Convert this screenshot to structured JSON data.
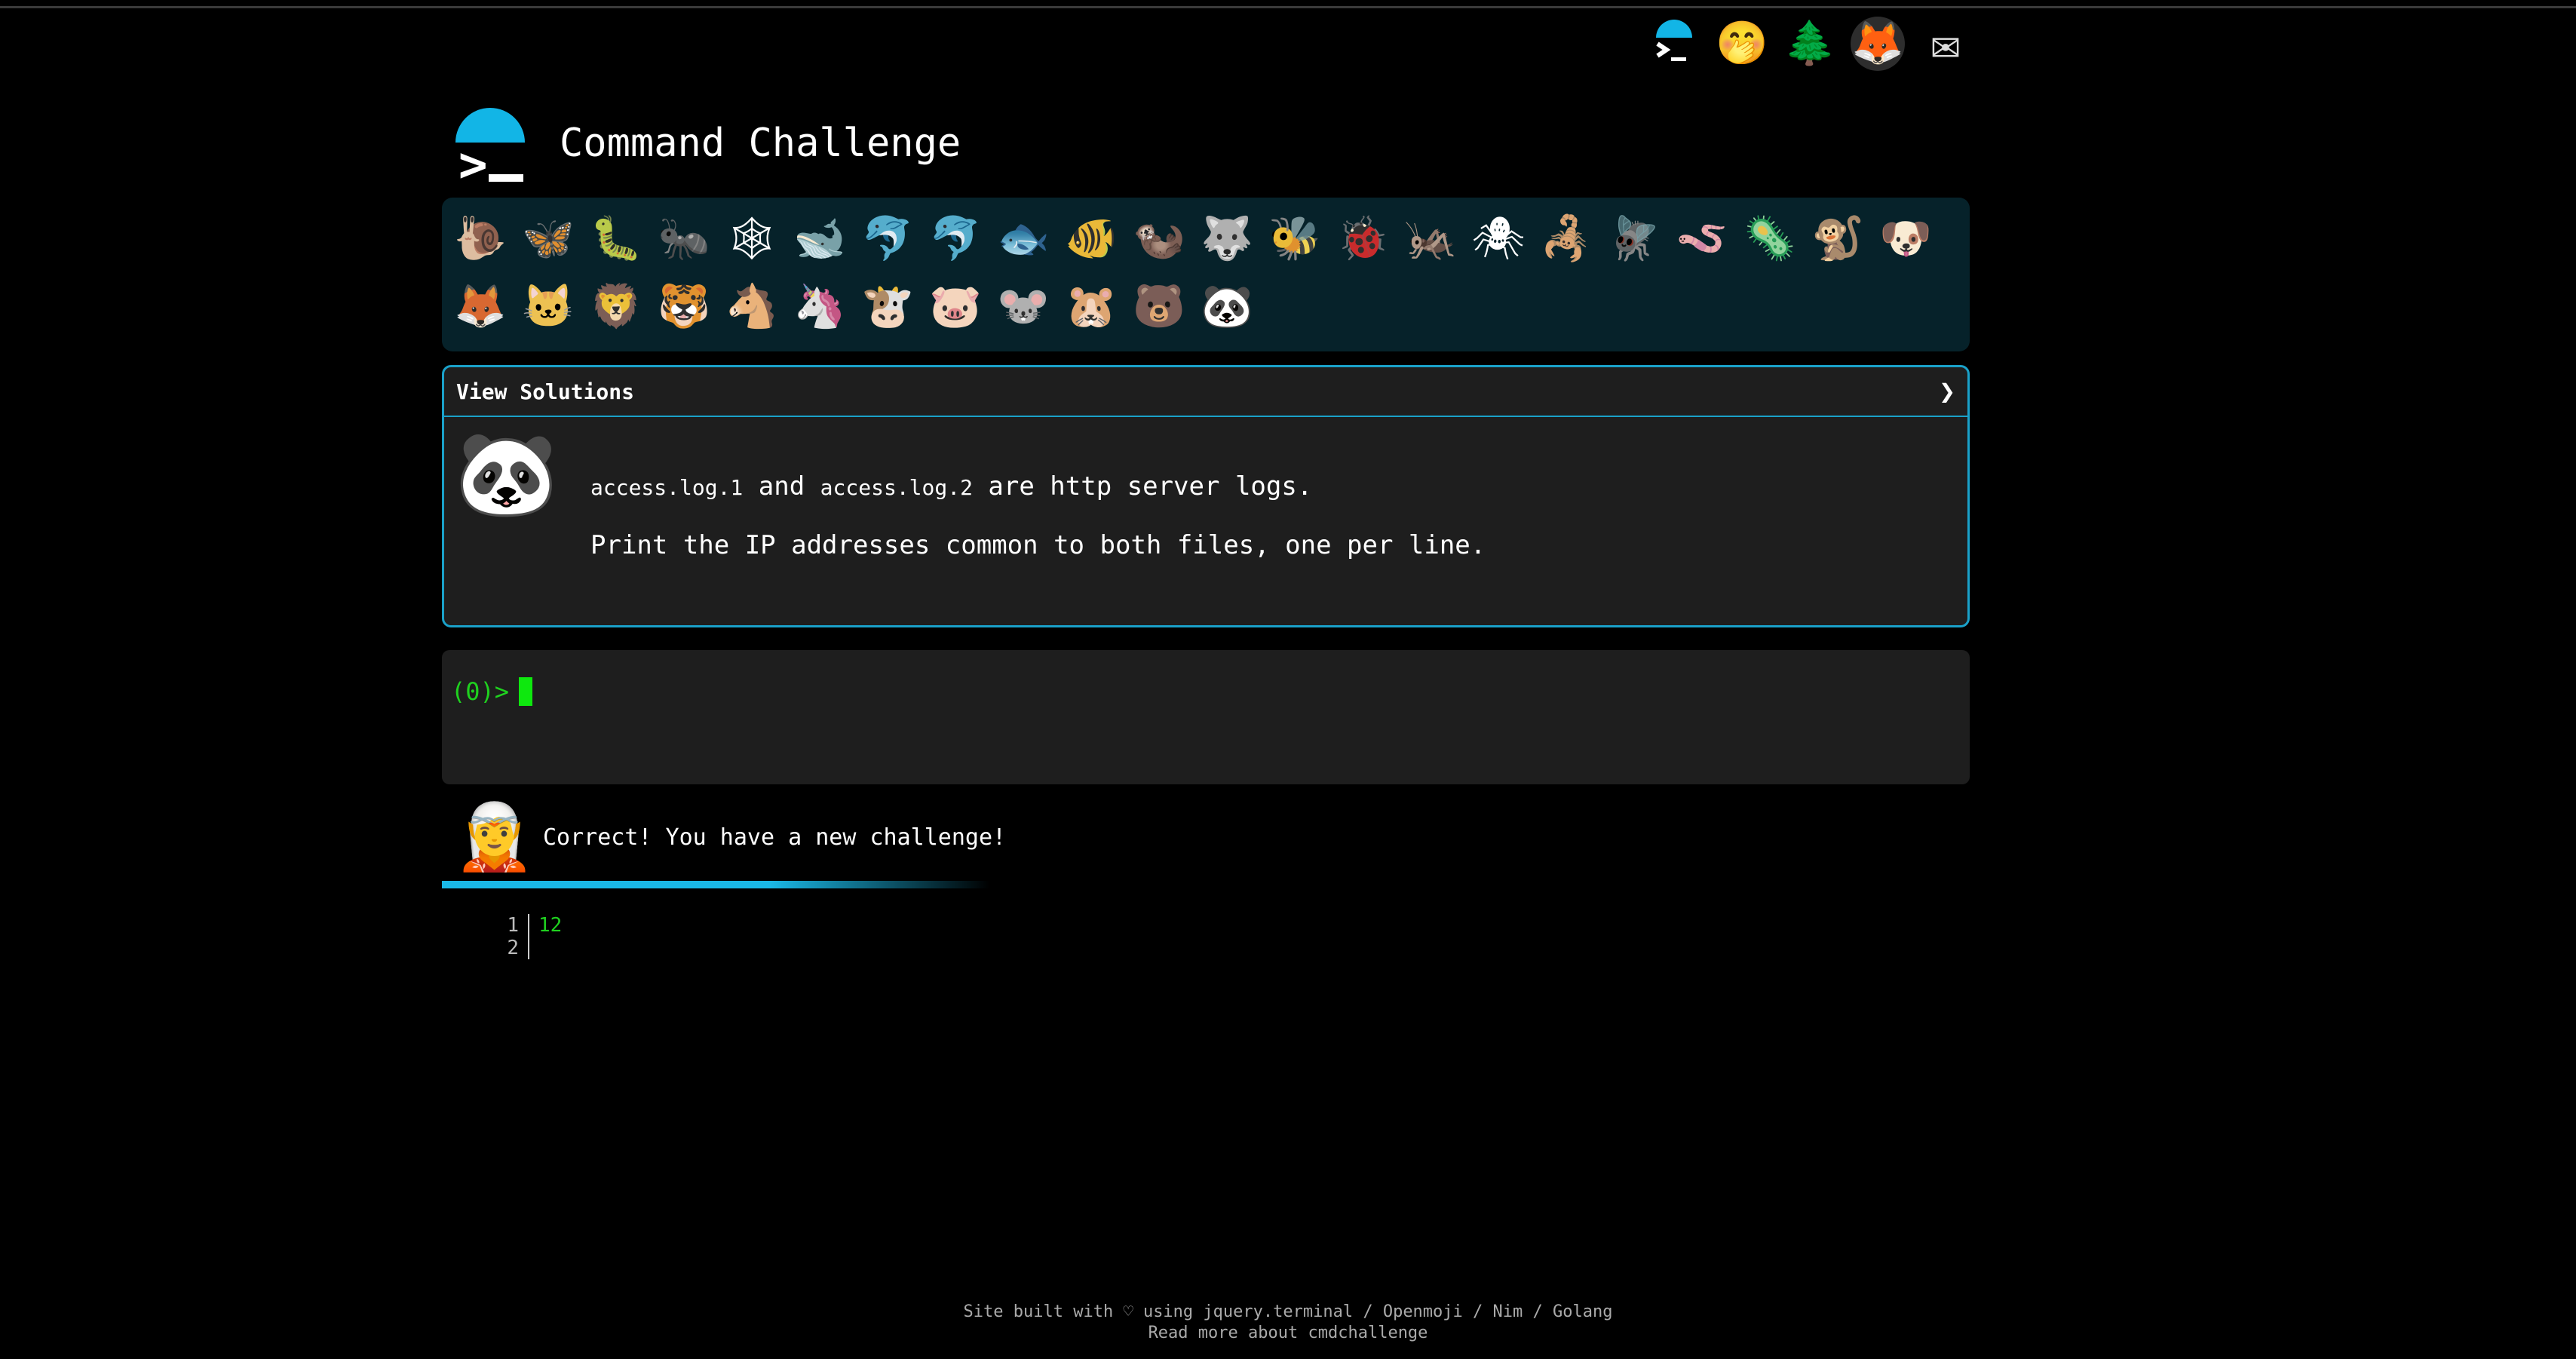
{
  "app": {
    "title": "Command Challenge"
  },
  "topbar": {
    "icons": [
      {
        "name": "cmd-logo-icon",
        "glyph": ">_"
      },
      {
        "name": "shushing-face-icon",
        "glyph": "🤭"
      },
      {
        "name": "tree-icon",
        "glyph": "🌲"
      },
      {
        "name": "gitlab-icon",
        "glyph": "🦊"
      },
      {
        "name": "mail-icon",
        "glyph": "✉"
      }
    ]
  },
  "animals": [
    "🐌",
    "🦋",
    "🐛",
    "🐜",
    "🕸",
    "🐋",
    "🐬",
    "🐬",
    "🐟",
    "🐠",
    "🦦",
    "🐺",
    "🐝",
    "🐞",
    "🦗",
    "🕷",
    "🦂",
    "🪰",
    "🪱",
    "🦠",
    "🐒",
    "🐶",
    "🦊",
    "🐱",
    "🦁",
    "🐯",
    "🐴",
    "🦄",
    "🐮",
    "🐷",
    "🐭",
    "🐹",
    "🐻",
    "🐼"
  ],
  "panel": {
    "header_label": "View Solutions",
    "chevron": "❯",
    "avatar": "🐼",
    "file1": "access.log.1",
    "and": " and ",
    "file2": "access.log.2",
    "line1_tail": " are http server logs.",
    "line2": "Print the IP addresses common to both files, one per line."
  },
  "terminal": {
    "prompt": "(0)>"
  },
  "feedback": {
    "avatar": "🧝",
    "text": "Correct! You have a new challenge!"
  },
  "progress": {
    "fraction": 0.6
  },
  "output": {
    "rows": [
      {
        "n": "1",
        "v": "12"
      },
      {
        "n": "2",
        "v": ""
      }
    ]
  },
  "footer": {
    "line1": "Site built with ♡ using jquery.terminal / Openmoji / Nim / Golang",
    "line2": "Read more about cmdchallenge"
  }
}
